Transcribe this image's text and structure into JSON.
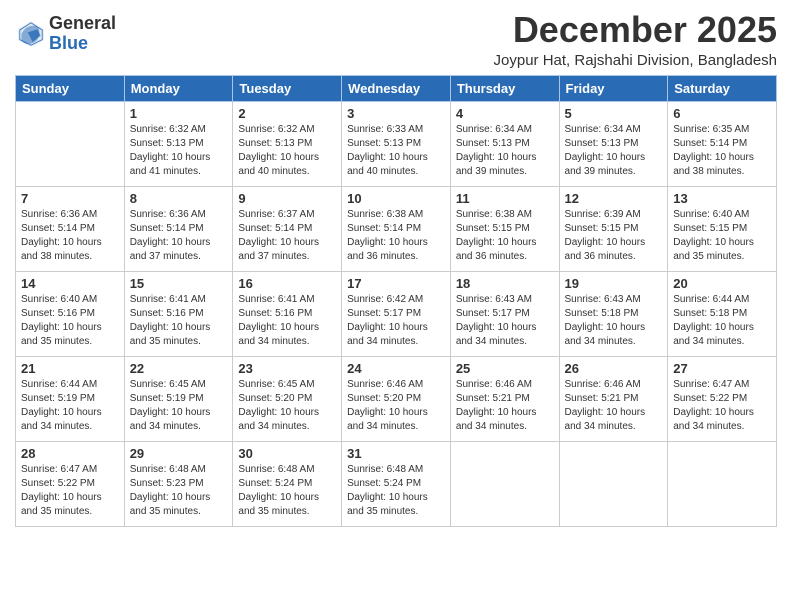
{
  "logo": {
    "general": "General",
    "blue": "Blue"
  },
  "header": {
    "month": "December 2025",
    "location": "Joypur Hat, Rajshahi Division, Bangladesh"
  },
  "days_of_week": [
    "Sunday",
    "Monday",
    "Tuesday",
    "Wednesday",
    "Thursday",
    "Friday",
    "Saturday"
  ],
  "weeks": [
    [
      {
        "day": "",
        "info": ""
      },
      {
        "day": "1",
        "info": "Sunrise: 6:32 AM\nSunset: 5:13 PM\nDaylight: 10 hours\nand 41 minutes."
      },
      {
        "day": "2",
        "info": "Sunrise: 6:32 AM\nSunset: 5:13 PM\nDaylight: 10 hours\nand 40 minutes."
      },
      {
        "day": "3",
        "info": "Sunrise: 6:33 AM\nSunset: 5:13 PM\nDaylight: 10 hours\nand 40 minutes."
      },
      {
        "day": "4",
        "info": "Sunrise: 6:34 AM\nSunset: 5:13 PM\nDaylight: 10 hours\nand 39 minutes."
      },
      {
        "day": "5",
        "info": "Sunrise: 6:34 AM\nSunset: 5:13 PM\nDaylight: 10 hours\nand 39 minutes."
      },
      {
        "day": "6",
        "info": "Sunrise: 6:35 AM\nSunset: 5:14 PM\nDaylight: 10 hours\nand 38 minutes."
      }
    ],
    [
      {
        "day": "7",
        "info": "Sunrise: 6:36 AM\nSunset: 5:14 PM\nDaylight: 10 hours\nand 38 minutes."
      },
      {
        "day": "8",
        "info": "Sunrise: 6:36 AM\nSunset: 5:14 PM\nDaylight: 10 hours\nand 37 minutes."
      },
      {
        "day": "9",
        "info": "Sunrise: 6:37 AM\nSunset: 5:14 PM\nDaylight: 10 hours\nand 37 minutes."
      },
      {
        "day": "10",
        "info": "Sunrise: 6:38 AM\nSunset: 5:14 PM\nDaylight: 10 hours\nand 36 minutes."
      },
      {
        "day": "11",
        "info": "Sunrise: 6:38 AM\nSunset: 5:15 PM\nDaylight: 10 hours\nand 36 minutes."
      },
      {
        "day": "12",
        "info": "Sunrise: 6:39 AM\nSunset: 5:15 PM\nDaylight: 10 hours\nand 36 minutes."
      },
      {
        "day": "13",
        "info": "Sunrise: 6:40 AM\nSunset: 5:15 PM\nDaylight: 10 hours\nand 35 minutes."
      }
    ],
    [
      {
        "day": "14",
        "info": "Sunrise: 6:40 AM\nSunset: 5:16 PM\nDaylight: 10 hours\nand 35 minutes."
      },
      {
        "day": "15",
        "info": "Sunrise: 6:41 AM\nSunset: 5:16 PM\nDaylight: 10 hours\nand 35 minutes."
      },
      {
        "day": "16",
        "info": "Sunrise: 6:41 AM\nSunset: 5:16 PM\nDaylight: 10 hours\nand 34 minutes."
      },
      {
        "day": "17",
        "info": "Sunrise: 6:42 AM\nSunset: 5:17 PM\nDaylight: 10 hours\nand 34 minutes."
      },
      {
        "day": "18",
        "info": "Sunrise: 6:43 AM\nSunset: 5:17 PM\nDaylight: 10 hours\nand 34 minutes."
      },
      {
        "day": "19",
        "info": "Sunrise: 6:43 AM\nSunset: 5:18 PM\nDaylight: 10 hours\nand 34 minutes."
      },
      {
        "day": "20",
        "info": "Sunrise: 6:44 AM\nSunset: 5:18 PM\nDaylight: 10 hours\nand 34 minutes."
      }
    ],
    [
      {
        "day": "21",
        "info": "Sunrise: 6:44 AM\nSunset: 5:19 PM\nDaylight: 10 hours\nand 34 minutes."
      },
      {
        "day": "22",
        "info": "Sunrise: 6:45 AM\nSunset: 5:19 PM\nDaylight: 10 hours\nand 34 minutes."
      },
      {
        "day": "23",
        "info": "Sunrise: 6:45 AM\nSunset: 5:20 PM\nDaylight: 10 hours\nand 34 minutes."
      },
      {
        "day": "24",
        "info": "Sunrise: 6:46 AM\nSunset: 5:20 PM\nDaylight: 10 hours\nand 34 minutes."
      },
      {
        "day": "25",
        "info": "Sunrise: 6:46 AM\nSunset: 5:21 PM\nDaylight: 10 hours\nand 34 minutes."
      },
      {
        "day": "26",
        "info": "Sunrise: 6:46 AM\nSunset: 5:21 PM\nDaylight: 10 hours\nand 34 minutes."
      },
      {
        "day": "27",
        "info": "Sunrise: 6:47 AM\nSunset: 5:22 PM\nDaylight: 10 hours\nand 34 minutes."
      }
    ],
    [
      {
        "day": "28",
        "info": "Sunrise: 6:47 AM\nSunset: 5:22 PM\nDaylight: 10 hours\nand 35 minutes."
      },
      {
        "day": "29",
        "info": "Sunrise: 6:48 AM\nSunset: 5:23 PM\nDaylight: 10 hours\nand 35 minutes."
      },
      {
        "day": "30",
        "info": "Sunrise: 6:48 AM\nSunset: 5:24 PM\nDaylight: 10 hours\nand 35 minutes."
      },
      {
        "day": "31",
        "info": "Sunrise: 6:48 AM\nSunset: 5:24 PM\nDaylight: 10 hours\nand 35 minutes."
      },
      {
        "day": "",
        "info": ""
      },
      {
        "day": "",
        "info": ""
      },
      {
        "day": "",
        "info": ""
      }
    ]
  ]
}
